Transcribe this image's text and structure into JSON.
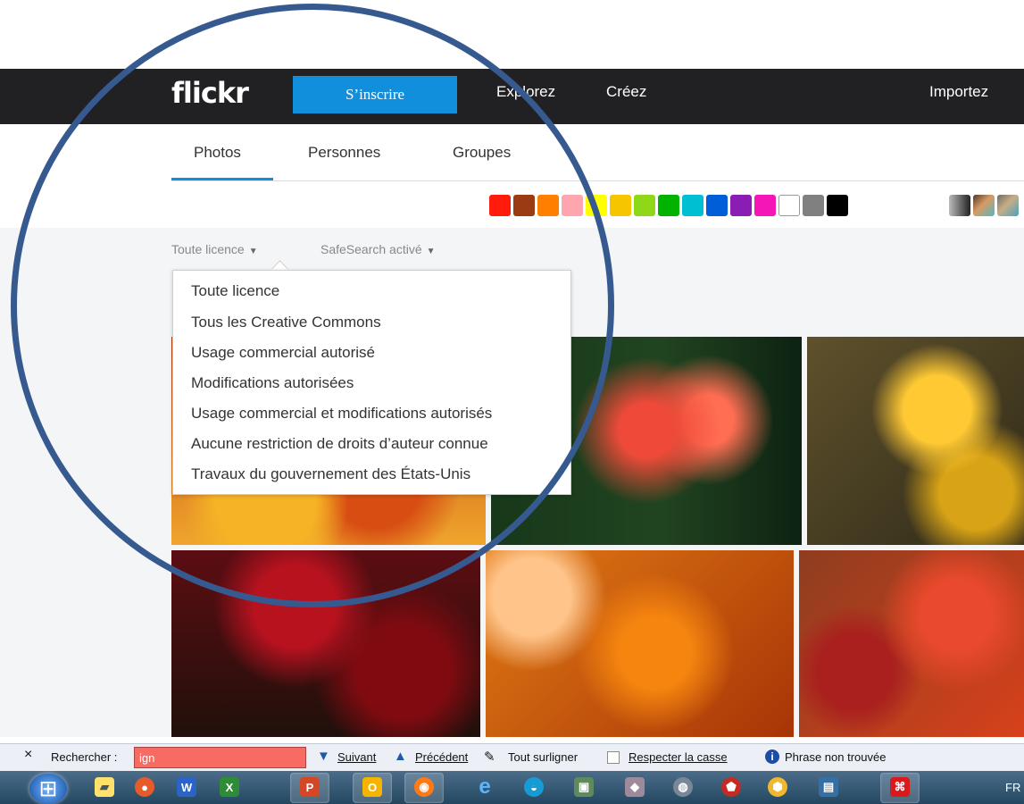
{
  "header": {
    "logo": "flickr",
    "signup_label": "S’inscrire",
    "nav": [
      "Explorez",
      "Créez",
      "Importez"
    ]
  },
  "tabs": [
    "Photos",
    "Personnes",
    "Groupes"
  ],
  "colors": {
    "swatches": [
      "#ff1c0d",
      "#9a3b13",
      "#ff7f00",
      "#ffa5b0",
      "#ffff00",
      "#f7c400",
      "#8ed819",
      "#00b300",
      "#00bfd2",
      "#005ed8",
      "#8a1db3",
      "#f516b8",
      "#ffffff",
      "#808080",
      "#000000"
    ],
    "accent": "#128fdc",
    "nav_background": "#212124",
    "find_input_background": "#f86b63"
  },
  "filters": {
    "license_label": "Toute licence",
    "safesearch_label": "SafeSearch activé"
  },
  "license_dropdown": {
    "items": [
      "Toute licence",
      "Tous les Creative Commons",
      "Usage commercial autorisé",
      "Modifications autorisées",
      "Usage commercial et modifications autorisés",
      "Aucune restriction de droits d’auteur connue",
      "Travaux du gouvernement des États-Unis"
    ]
  },
  "findbar": {
    "close": "×",
    "search_label": "Rechercher :",
    "search_value": "ign",
    "next": "Suivant",
    "previous": "Précédent",
    "highlight_all": "Tout surligner",
    "match_case": "Respecter la casse",
    "status": "Phrase non trouvée"
  },
  "taskbar": {
    "language": "FR"
  },
  "icons": {
    "down_arrow": "▼",
    "up_arrow": "▲"
  }
}
